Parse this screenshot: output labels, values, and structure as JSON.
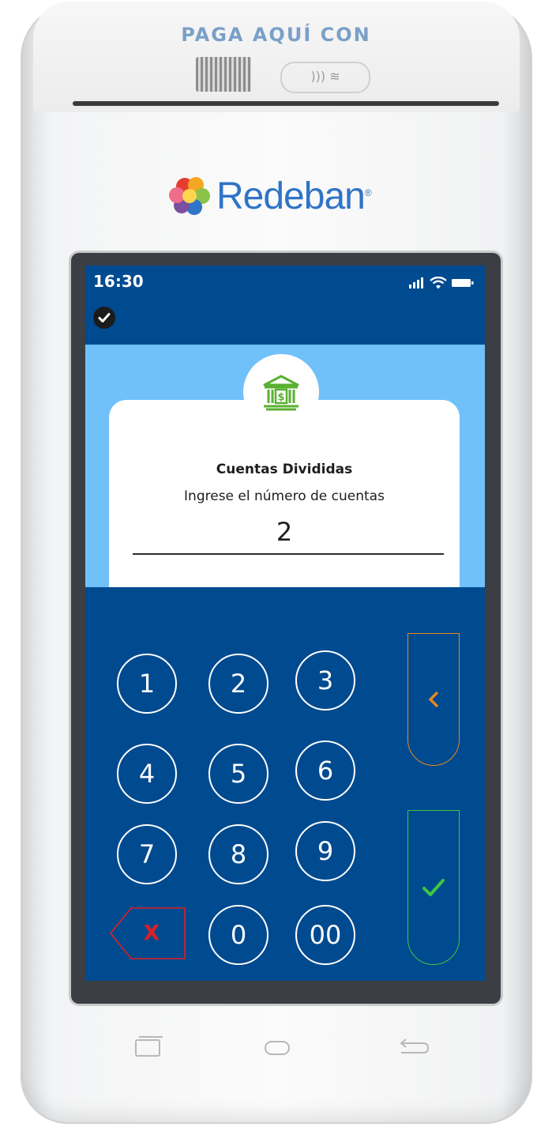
{
  "device": {
    "header_text": "PAGA AQUÍ CON",
    "nfc_label": "))) ≋",
    "brand": "Redeban",
    "brand_mark": "®"
  },
  "status_bar": {
    "time": "16:30"
  },
  "card": {
    "title": "Cuentas Divididas",
    "subtitle": "Ingrese el número de cuentas",
    "value": "2"
  },
  "keypad": {
    "keys": [
      "1",
      "2",
      "3",
      "4",
      "5",
      "6",
      "7",
      "8",
      "9",
      "0",
      "00"
    ],
    "clear_label": "X"
  },
  "colors": {
    "dark_blue": "#004a90",
    "light_blue": "#70c0fa",
    "back_orange": "#e68a1e",
    "confirm_green": "#3ec83e",
    "clear_red": "#e02020",
    "bank_green": "#5ab031"
  },
  "icons": {
    "bank": "bank-icon",
    "back": "chevron-left-icon",
    "confirm": "check-icon",
    "clear": "clear-x-icon",
    "status_check": "check-circle-icon"
  }
}
